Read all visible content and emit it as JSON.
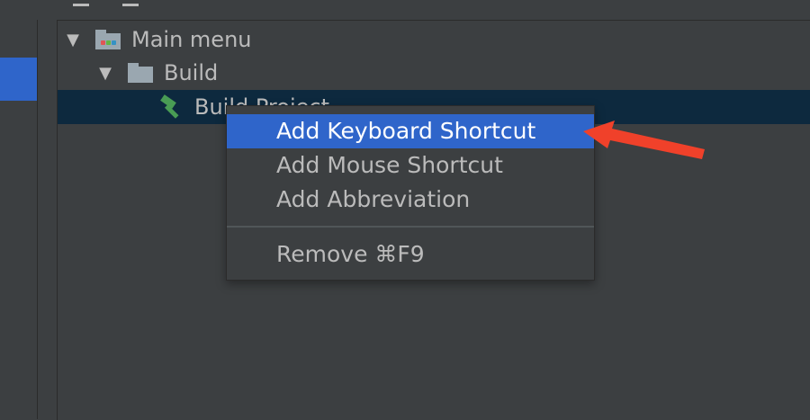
{
  "tree": {
    "root_label": "Main menu",
    "group_label": "Build",
    "item_label": "Build Project"
  },
  "context_menu": {
    "items": [
      {
        "label": "Add Keyboard Shortcut"
      },
      {
        "label": "Add Mouse Shortcut"
      },
      {
        "label": "Add Abbreviation"
      }
    ],
    "remove_label": "Remove ⌘F9"
  },
  "colors": {
    "highlight": "#2f65ca",
    "annotation_arrow": "#f0412a"
  },
  "icons": {
    "root": "menu-folder-icon",
    "group": "folder-icon",
    "item": "hammer-icon"
  }
}
